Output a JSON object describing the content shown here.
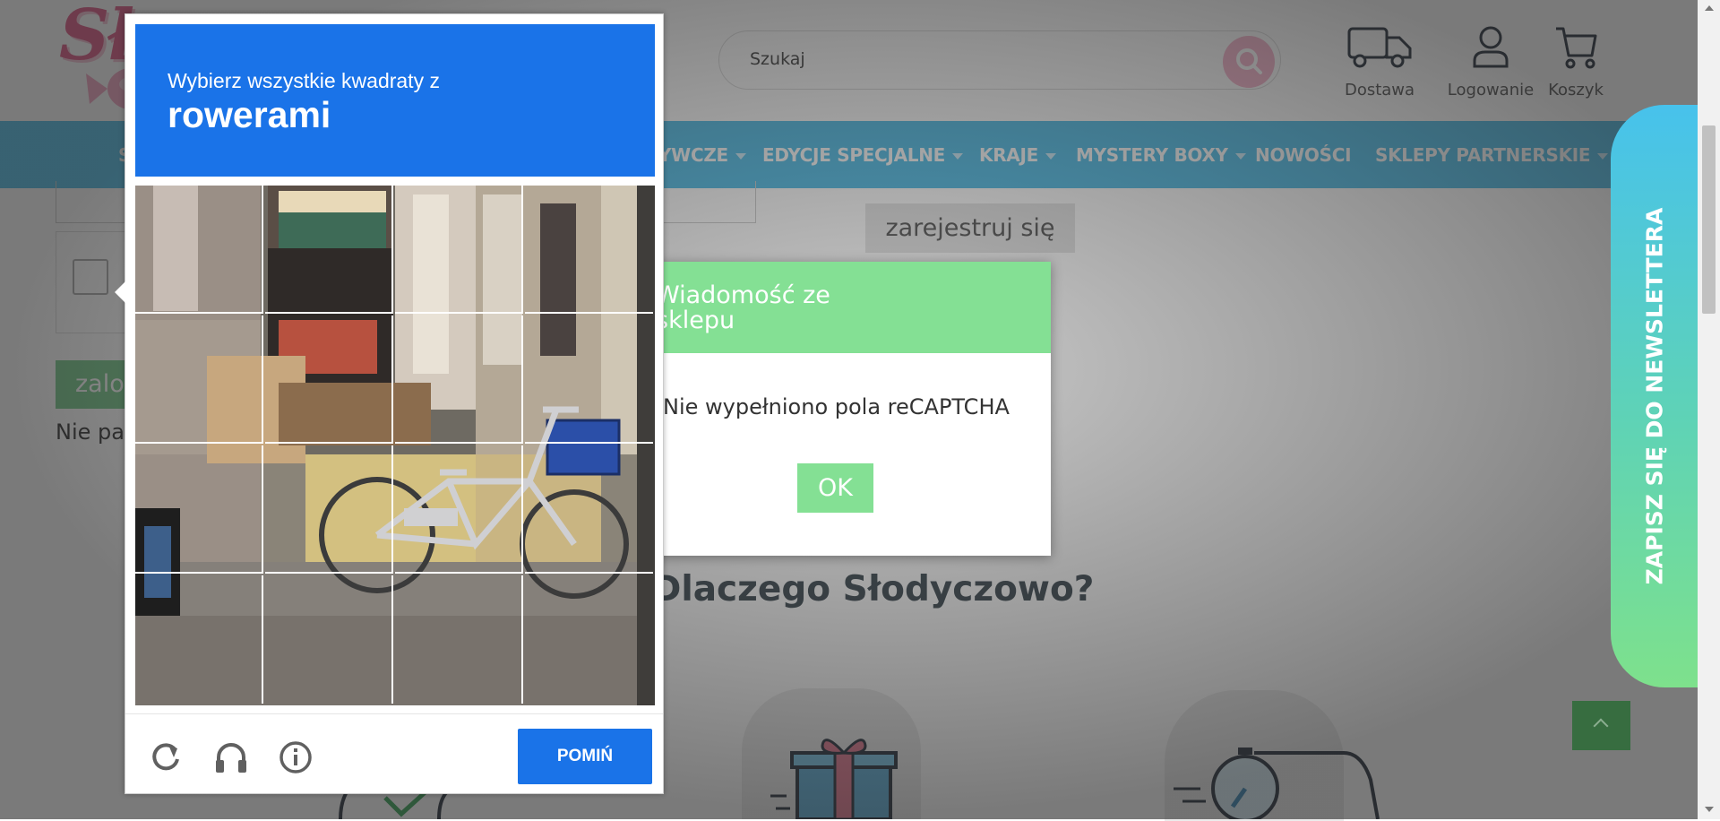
{
  "header": {
    "logo_text": "Sło",
    "search_placeholder": "Szukaj",
    "delivery_label": "Dostawa",
    "login_label": "Logowanie",
    "cart_label": "Koszyk"
  },
  "nav": {
    "items": [
      {
        "label": "S",
        "has_caret": false
      },
      {
        "label": "YWCZE",
        "has_caret": true
      },
      {
        "label": "EDYCJE SPECJALNE",
        "has_caret": true
      },
      {
        "label": "KRAJE",
        "has_caret": true
      },
      {
        "label": "MYSTERY BOXY",
        "has_caret": true
      },
      {
        "label": "NOWOŚCI",
        "has_caret": false
      },
      {
        "label": "SKLEPY PARTNERSKIE",
        "has_caret": true
      }
    ]
  },
  "page": {
    "register_button": "zarejestruj się",
    "green_button_fragment": "zalo",
    "text_fragment": "Nie pa",
    "section_title": "Dlaczego Słodyczowo?"
  },
  "message_dialog": {
    "title": "Wiadomość ze sklepu",
    "body": "Nie wypełniono pola reCAPTCHA",
    "ok_label": "OK"
  },
  "newsletter_tab": {
    "label": "ZAPISZ SIĘ DO NEWSLETTERA"
  },
  "captcha": {
    "instruction": "Wybierz wszystkie kwadraty z",
    "target": "rowerami",
    "skip_label": "POMIŃ",
    "grid_rows": 4,
    "grid_cols": 4,
    "icons": [
      "reload-icon",
      "headphones-icon",
      "info-icon"
    ]
  },
  "colors": {
    "nav_bg": "#52bfe9",
    "captcha_blue": "#1a73e8",
    "dialog_green": "#84e094",
    "brand_pink": "#e05a86"
  }
}
